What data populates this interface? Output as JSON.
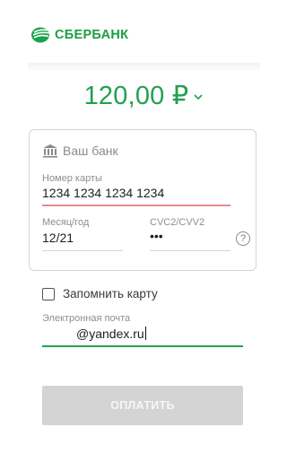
{
  "header": {
    "logo_text": "СБЕРБАНК"
  },
  "payment": {
    "amount": "120,00 ₽"
  },
  "card_form": {
    "bank_name": "Ваш банк",
    "card_number_label": "Номер карты",
    "card_number_value": "1234 1234 1234 1234",
    "expiry_label": "Месяц/год",
    "expiry_value": "12/21",
    "cvc_label": "CVC2/CVV2",
    "cvc_value": "•••",
    "help_glyph": "?"
  },
  "remember": {
    "label": "Запомнить карту",
    "checked": false
  },
  "email": {
    "label": "Электронная почта",
    "value": "@yandex.ru"
  },
  "actions": {
    "pay_label": "ОПЛАТИТЬ"
  },
  "colors": {
    "brand_green": "#23a050",
    "error_underline": "#e38b8b",
    "disabled_button": "#d4d4d4"
  },
  "icons": [
    "sberbank-logo-icon",
    "chevron-down-icon",
    "bank-building-icon",
    "question-circle-icon"
  ]
}
